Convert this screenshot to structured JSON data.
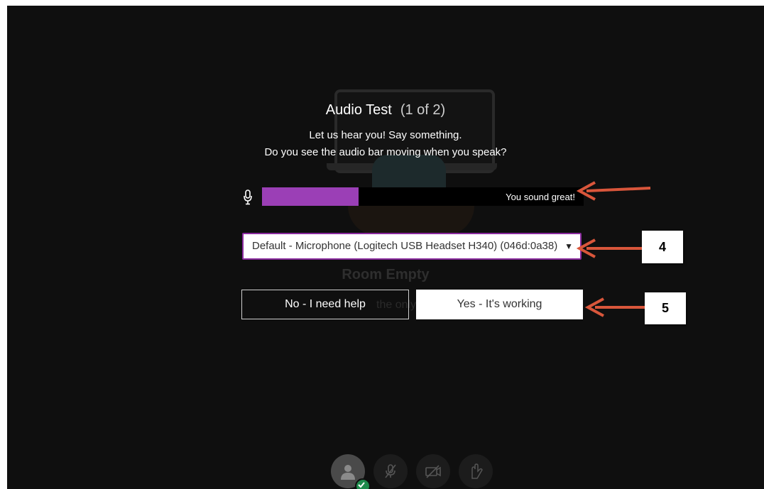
{
  "dialog": {
    "title": "Audio Test",
    "step_counter": "(1 of 2)",
    "prompt_line1": "Let us hear you! Say something.",
    "prompt_line2": "Do you see the audio bar moving when you speak?"
  },
  "audio_meter": {
    "level_fraction": 0.3,
    "status_text": "You sound great!",
    "fill_color": "#9b3fb6"
  },
  "microphone_select": {
    "selected_value": "Default - Microphone (Logitech USB Headset H340) (046d:0a38)"
  },
  "buttons": {
    "no_label": "No - I need help",
    "yes_label": "Yes - It's working"
  },
  "background_room": {
    "title": "Room Empty",
    "subtitle_fragment": "the only o"
  },
  "control_bar": {
    "items": [
      "avatar-icon",
      "microphone-muted-icon",
      "camera-off-icon",
      "raise-hand-icon"
    ]
  },
  "annotations": {
    "callout_4": "4",
    "callout_5": "5",
    "arrow_color": "#d9563b"
  }
}
